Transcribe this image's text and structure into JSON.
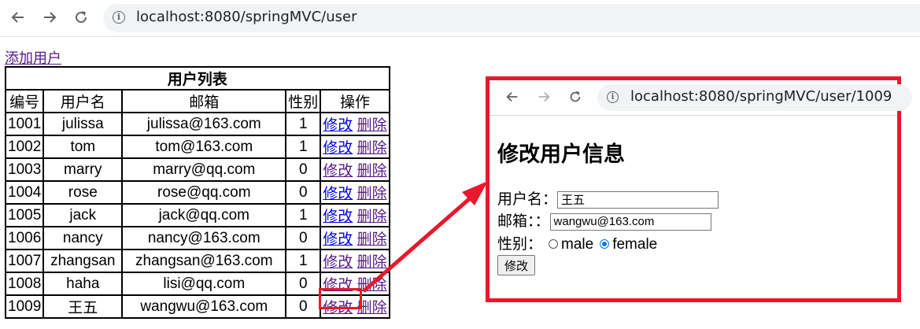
{
  "browser": {
    "url": "localhost:8080/springMVC/user"
  },
  "page": {
    "add_user_link": "添加用户",
    "table": {
      "caption": "用户列表",
      "headers": [
        "编号",
        "用户名",
        "邮箱",
        "性别",
        "操作"
      ],
      "edit_label": "修改",
      "delete_label": "删除",
      "rows": [
        {
          "id": "1001",
          "name": "julissa",
          "email": "julissa@163.com",
          "gender": "1"
        },
        {
          "id": "1002",
          "name": "tom",
          "email": "tom@163.com",
          "gender": "1"
        },
        {
          "id": "1003",
          "name": "marry",
          "email": "marry@qq.com",
          "gender": "0"
        },
        {
          "id": "1004",
          "name": "rose",
          "email": "rose@qq.com",
          "gender": "0"
        },
        {
          "id": "1005",
          "name": "jack",
          "email": "jack@qq.com",
          "gender": "1"
        },
        {
          "id": "1006",
          "name": "nancy",
          "email": "nancy@163.com",
          "gender": "0"
        },
        {
          "id": "1007",
          "name": "zhangsan",
          "email": "zhangsan@163.com",
          "gender": "1"
        },
        {
          "id": "1008",
          "name": "haha",
          "email": "lisi@qq.com",
          "gender": "0"
        },
        {
          "id": "1009",
          "name": "王五",
          "email": "wangwu@163.com",
          "gender": "0"
        }
      ]
    }
  },
  "inset": {
    "url": "localhost:8080/springMVC/user/1009",
    "title": "修改用户信息",
    "username_label": "用户名：",
    "username_value": "王五",
    "email_label": "邮箱：：",
    "email_value": "wangwu@163.com",
    "gender_label": "性别：",
    "gender_options": [
      "male",
      "female"
    ],
    "gender_selected": "female",
    "submit_label": "修改"
  },
  "colors": {
    "highlight": "#e8192c",
    "link": "#0000ee",
    "visited_link": "#551a8b",
    "radio_checked": "#0075ff"
  },
  "icons": [
    "back-arrow-icon",
    "forward-arrow-icon",
    "reload-icon",
    "info-icon"
  ]
}
